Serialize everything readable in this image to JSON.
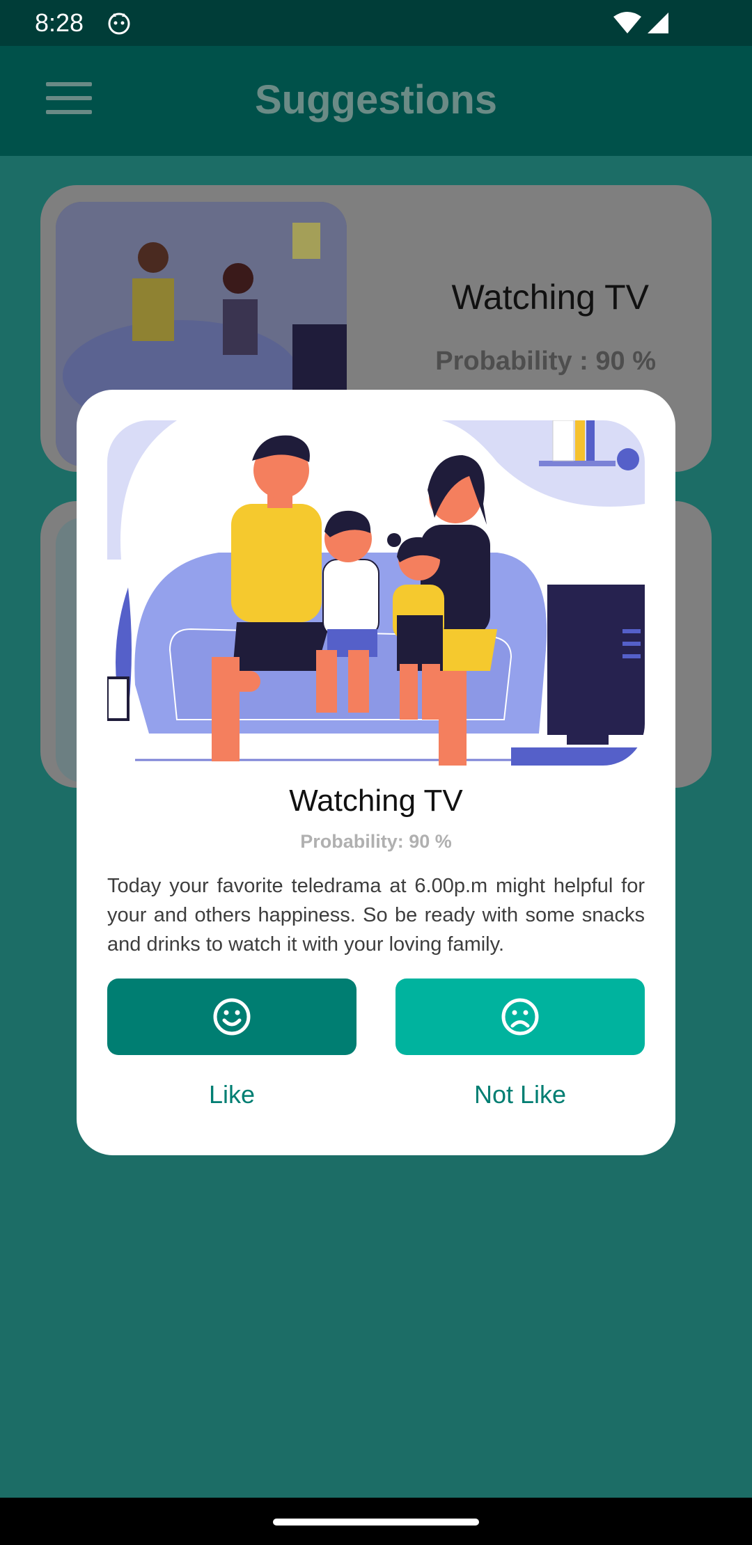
{
  "status_bar": {
    "time": "8:28"
  },
  "app_bar": {
    "title": "Suggestions"
  },
  "cards": [
    {
      "title": "Watching TV",
      "probability": "Probability : 90 %"
    }
  ],
  "dialog": {
    "title": "Watching TV",
    "probability": "Probability: 90 %",
    "description": "Today your favorite teledrama at 6.00p.m might helpful for your and others happiness. So be ready with some snacks and drinks to watch it with your loving family.",
    "like_label": "Like",
    "not_like_label": "Not Like"
  },
  "colors": {
    "status_bar": "#003d38",
    "app_bar": "#00514a",
    "background": "#1c6d66",
    "like_button": "#007e72",
    "not_like_button": "#00b39e",
    "accent_text": "#007e72"
  },
  "icons": {
    "menu": "menu-icon",
    "like": "smile-icon",
    "not_like": "frown-icon",
    "wifi": "wifi-icon",
    "signal": "signal-icon"
  }
}
